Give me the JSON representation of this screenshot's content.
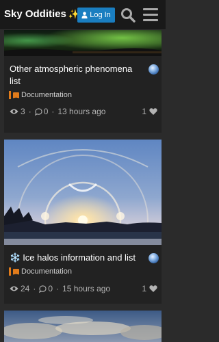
{
  "header": {
    "site_title": "Sky Oddities",
    "sparkle": "✨",
    "login_label": "Log In"
  },
  "topics": [
    {
      "title": "Other atmospheric phenomena list",
      "category": "Documentation",
      "views": "3",
      "replies": "0",
      "activity": "13 hours ago",
      "likes": "1"
    },
    {
      "title_prefix": "❄️",
      "title": "Ice halos information and list",
      "category": "Documentation",
      "views": "24",
      "replies": "0",
      "activity": "15 hours ago",
      "likes": "1"
    }
  ],
  "colors": {
    "header_bg": "#191919",
    "login_button": "#1a7ec0",
    "category_accent": "#e07b1b"
  }
}
